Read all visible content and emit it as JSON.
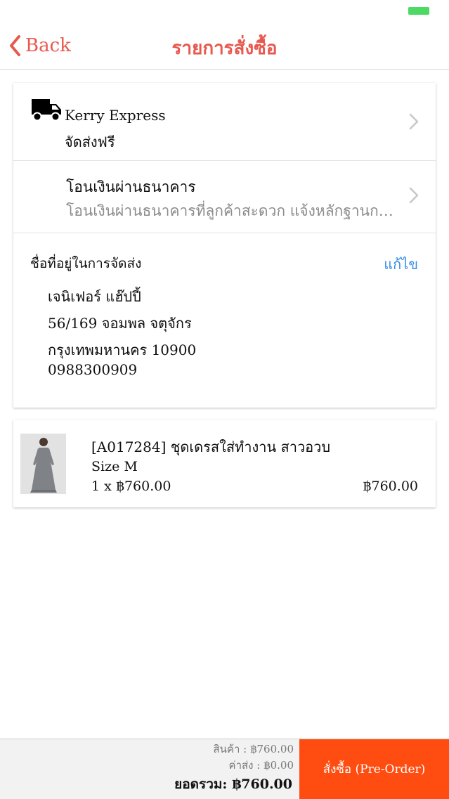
{
  "nav": {
    "back_label": "Back",
    "title": "รายการสั่งซื้อ"
  },
  "shipping": {
    "icon": "truck-icon",
    "carrier": "Kerry Express",
    "fee_note": "จัดส่งฟรี"
  },
  "payment": {
    "method": "โอนเงินผ่านธนาคาร",
    "description": "โอนเงินผ่านธนาคารที่ลูกค้าสะดวก แจ้งหลักฐานการโอนเงิน"
  },
  "address": {
    "heading": "ชื่อที่อยู่ในการจัดส่ง",
    "edit_label": "แก้ไข",
    "name": "เจนิเฟอร์ แฮ๊ปปี้",
    "line1": "56/169 จอมพล จตุจักร",
    "line2": "กรุงเทพมหานคร 10900",
    "phone": "0988300909"
  },
  "items": [
    {
      "name": "[A017284] ชุดเดรสใส่ทำงาน สาวอวบ",
      "size": "Size M",
      "qty_price": "1 x ฿760.00",
      "line_total": "฿760.00"
    }
  ],
  "summary": {
    "goods": "สินค้า : ฿760.00",
    "shipping": "ค่าส่ง : ฿0.00",
    "total_label": "ยอดรวม: ",
    "total_value": "฿760.00",
    "order_button": "สั่งซื้อ (Pre-Order)"
  },
  "colors": {
    "accent": "#e8584f",
    "link": "#3a8ee6",
    "order_button": "#ff4d12",
    "battery": "#4cd964"
  }
}
